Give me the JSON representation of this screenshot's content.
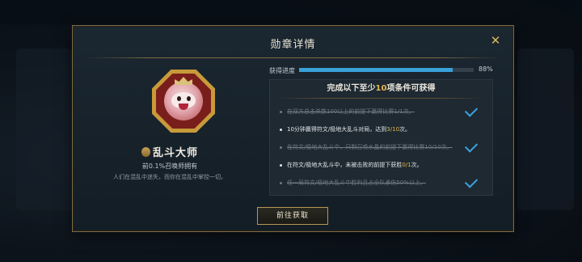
{
  "modal": {
    "title": "勋章详情",
    "close_label": "✕"
  },
  "badge": {
    "name": "乱斗大师",
    "rarity": "前0.1%召唤师拥有",
    "description": "人们在混乱中迷失，而你在混乱中掌控一切。"
  },
  "progress": {
    "label": "获得进度",
    "value_text": "88%",
    "value": 0.88
  },
  "conditions_panel": {
    "header_prefix": "完成以下至少",
    "header_count": "10",
    "header_suffix": "项条件可获得",
    "items": [
      {
        "state": "done",
        "text": "在双方总击杀数100以上的前提下赢得比赛1/1次。"
      },
      {
        "state": "active",
        "text_before": "10分钟赢得符文/极地大乱斗对局，达到",
        "highlight": "3/10",
        "text_after": "次。"
      },
      {
        "state": "done",
        "text": "在符文/极地大乱斗中，只剩召唤水晶的前提下赢得比赛10/10次。"
      },
      {
        "state": "active",
        "text_before": "在符文/极地大乱斗中，未被击败的前提下获胜",
        "highlight": "0/1",
        "text_after": "次。"
      },
      {
        "state": "done",
        "text": "任一局符文/极地大乱斗中胜利且占全队承伤50%以上。"
      }
    ]
  },
  "actions": {
    "go_label": "前往获取"
  },
  "colors": {
    "accent_gold": "#e2b84d",
    "progress_blue": "#3aa0d8",
    "check_blue": "#3fa3e0"
  }
}
